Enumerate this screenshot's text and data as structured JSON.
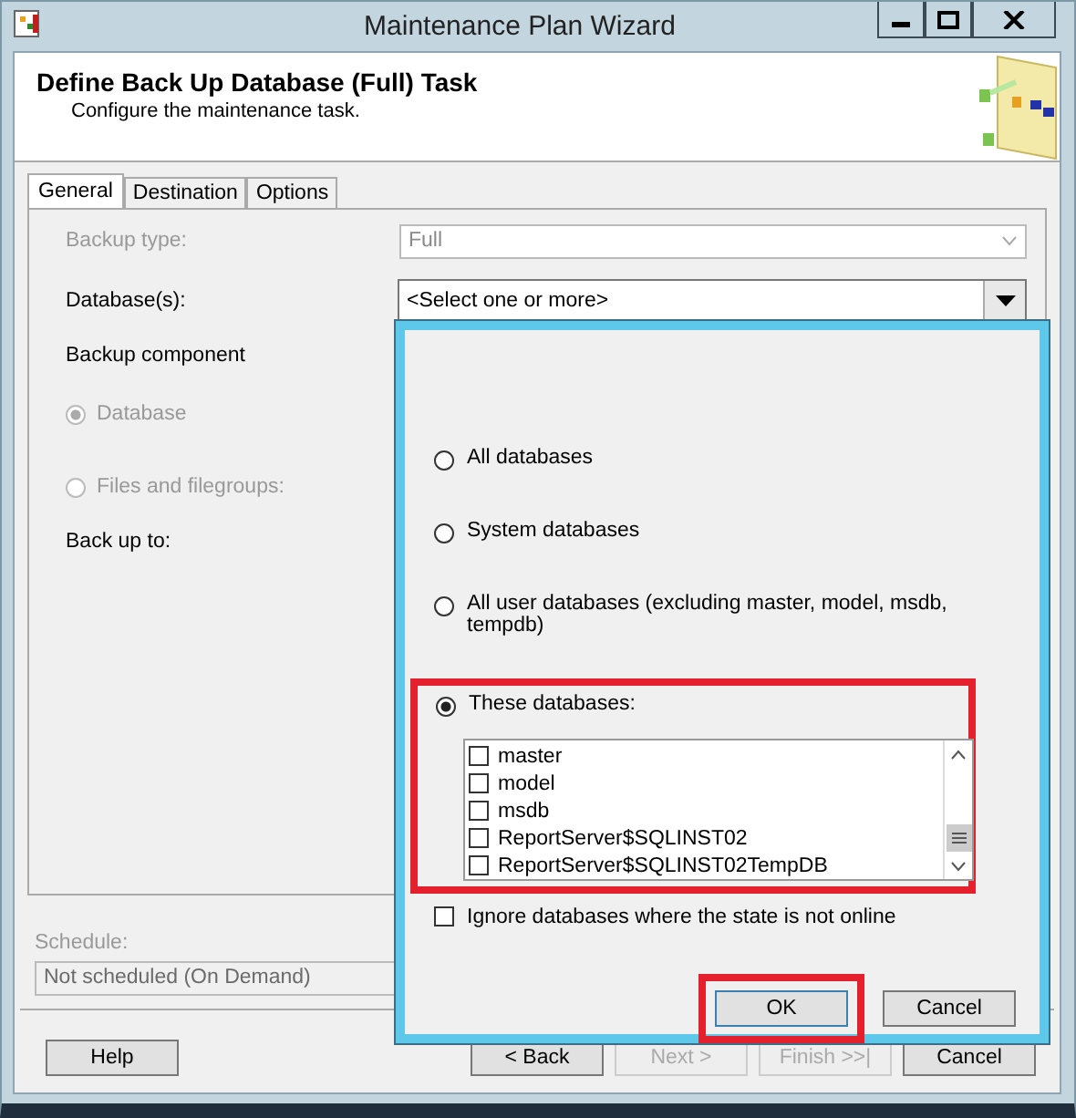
{
  "window": {
    "title": "Maintenance Plan Wizard"
  },
  "header": {
    "title": "Define Back Up Database (Full) Task",
    "subtitle": "Configure the maintenance task."
  },
  "tabs": [
    {
      "label": "General",
      "selected": true
    },
    {
      "label": "Destination",
      "selected": false
    },
    {
      "label": "Options",
      "selected": false
    }
  ],
  "form": {
    "backup_type": {
      "label": "Backup type:",
      "value": "Full",
      "disabled": true
    },
    "databases": {
      "label": "Database(s):",
      "value": "<Select one or more>"
    },
    "backup_component": {
      "label": "Backup component",
      "options": [
        {
          "label": "Database",
          "selected": true,
          "disabled": true
        },
        {
          "label": "Files and filegroups:",
          "selected": false,
          "disabled": true
        }
      ]
    },
    "back_up_to": {
      "label": "Back up to:"
    }
  },
  "schedule": {
    "label": "Schedule:",
    "value": "Not scheduled (On Demand)"
  },
  "buttons": [
    {
      "label": "Help",
      "disabled": false
    },
    {
      "label": "< Back",
      "disabled": false
    },
    {
      "label": "Next >",
      "disabled": true
    },
    {
      "label": "Finish >>|",
      "disabled": true
    },
    {
      "label": "Cancel",
      "disabled": false
    }
  ],
  "popup": {
    "options": [
      {
        "label": "All databases",
        "selected": false
      },
      {
        "label": "System databases",
        "selected": false
      },
      {
        "label": "All user databases  (excluding master, model, msdb, tempdb)",
        "selected": false
      },
      {
        "label": "These databases:",
        "selected": true
      }
    ],
    "databases": [
      {
        "name": "master",
        "checked": false
      },
      {
        "name": "model",
        "checked": false
      },
      {
        "name": "msdb",
        "checked": false
      },
      {
        "name": "ReportServer$SQLINST02",
        "checked": false
      },
      {
        "name": "ReportServer$SQLINST02TempDB",
        "checked": false
      }
    ],
    "ignore_offline": {
      "label": "Ignore databases where the state is not online",
      "checked": false
    },
    "buttons": [
      {
        "label": "OK",
        "highlighted": true
      },
      {
        "label": "Cancel",
        "highlighted": false
      }
    ]
  }
}
